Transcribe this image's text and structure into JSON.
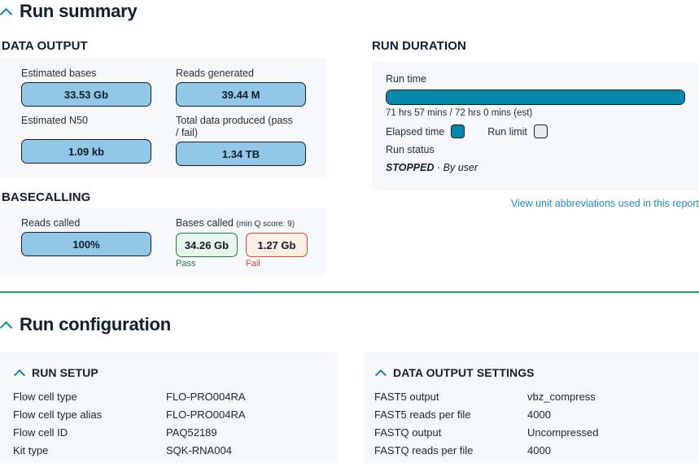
{
  "run_summary": {
    "title": "Run summary",
    "chevron_icon": "chevron-up-icon",
    "data_output": {
      "heading": "DATA OUTPUT",
      "metrics": [
        {
          "label": "Estimated bases",
          "value": "33.53 Gb"
        },
        {
          "label": "Reads generated",
          "value": "39.44 M"
        },
        {
          "label": "Estimated N50",
          "value": "1.09 kb"
        },
        {
          "label": "Total data produced (pass / fail)",
          "value": "1.34 TB"
        }
      ]
    },
    "basecalling": {
      "heading": "BASECALLING",
      "reads_called_label": "Reads called",
      "reads_called_value": "100%",
      "bases_called_label": "Bases called",
      "bases_called_note": "(min Q score: 9)",
      "pass_value": "34.26 Gb",
      "pass_caption": "Pass",
      "fail_value": "1.27 Gb",
      "fail_caption": "Fail"
    },
    "run_duration": {
      "heading": "RUN DURATION",
      "run_time_label": "Run time",
      "progress_percent": 99.9,
      "progress_text": "71 hrs 57 mins / 72 hrs 0 mins (est)",
      "legend_elapsed": "Elapsed time",
      "legend_limit": "Run limit",
      "run_status_label": "Run status",
      "status_value": "STOPPED",
      "status_detail": "· By user"
    },
    "unit_link": "View unit abbreviations used in this report"
  },
  "run_configuration": {
    "title": "Run configuration",
    "chevron_icon": "chevron-up-icon",
    "run_setup": {
      "heading": "RUN SETUP",
      "rows": [
        {
          "key": "Flow cell type",
          "value": "FLO-PRO004RA"
        },
        {
          "key": "Flow cell type alias",
          "value": "FLO-PRO004RA"
        },
        {
          "key": "Flow cell ID",
          "value": "PAQ52189"
        },
        {
          "key": "Kit type",
          "value": "SQK-RNA004"
        }
      ]
    },
    "data_output_settings": {
      "heading": "DATA OUTPUT SETTINGS",
      "rows": [
        {
          "key": "FAST5 output",
          "value": "vbz_compress"
        },
        {
          "key": "FAST5 reads per file",
          "value": "4000"
        },
        {
          "key": "FASTQ output",
          "value": "Uncompressed"
        },
        {
          "key": "FASTQ reads per file",
          "value": "4000"
        }
      ]
    }
  },
  "colors": {
    "accent_teal": "#1484a8",
    "progress_teal": "#0387ad",
    "metric_blue": "#93c7e8",
    "pass_green": "#1f7a45",
    "fail_red": "#d94a32",
    "divider_green": "#16a97b",
    "panel_bg": "#f7f8f9"
  }
}
